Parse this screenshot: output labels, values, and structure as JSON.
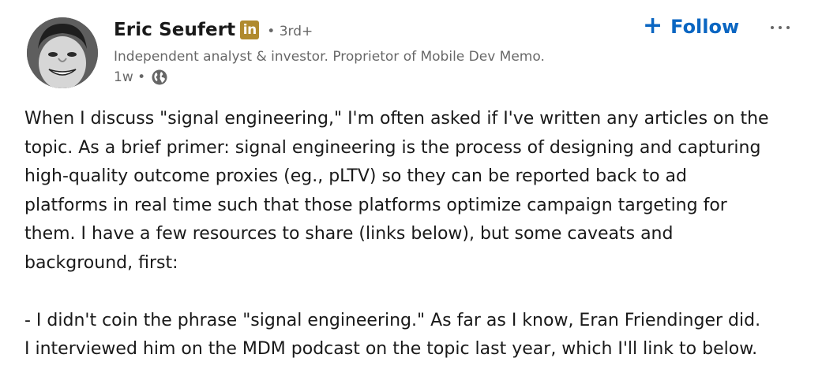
{
  "author": {
    "name": "Eric Seufert",
    "badge_text": "in",
    "degree": "• 3rd+",
    "headline": "Independent analyst & investor. Proprietor of Mobile Dev Memo.",
    "time": "1w •",
    "visibility_icon": "globe-icon",
    "avatar_icon": "profile-photo"
  },
  "actions": {
    "follow_plus": "+",
    "follow_label": "Follow",
    "more_icon": "ellipsis-icon"
  },
  "post": {
    "lines": [
      "When I discuss \"signal engineering,\" I'm often asked if I've written any articles on the",
      "topic. As a brief primer: signal engineering is the process of designing and capturing",
      "high-quality outcome proxies (eg., pLTV) so they can be reported back to ad",
      "platforms in real time such that those platforms optimize campaign targeting for",
      "them. I have a few resources to share (links below), but some caveats and",
      "background, first:",
      "",
      "- I didn't coin the phrase \"signal engineering.\" As far as I know, Eran Friendinger did.",
      "I interviewed him on the MDM podcast on the topic last year, which I'll link to below."
    ]
  },
  "colors": {
    "accent": "#0a66c2",
    "badge": "#b08a2e",
    "text_primary": "#191919",
    "text_secondary": "#666666"
  }
}
